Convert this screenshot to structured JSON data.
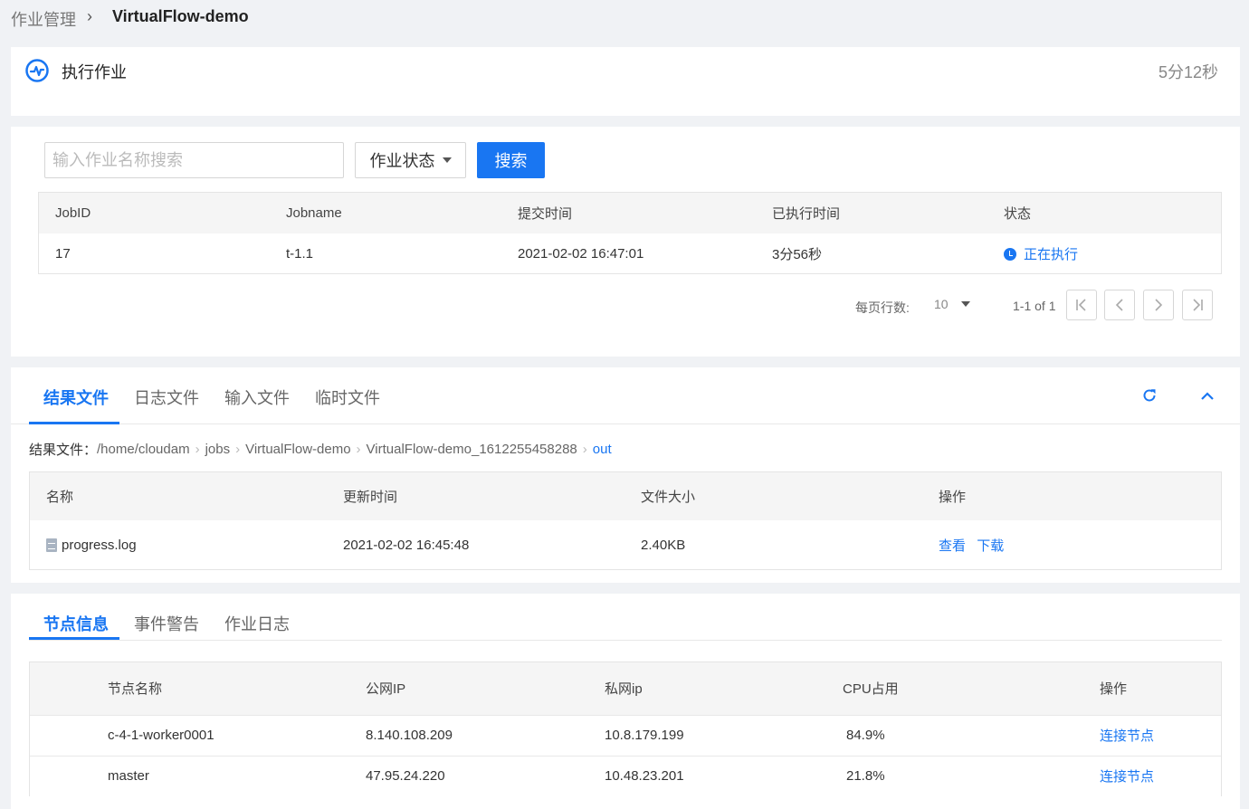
{
  "breadcrumb": {
    "root": "作业管理",
    "current": "VirtualFlow-demo"
  },
  "job_header": {
    "title": "执行作业",
    "elapsed": "5分12秒"
  },
  "search": {
    "placeholder": "输入作业名称搜索",
    "status_label": "作业状态",
    "button": "搜索"
  },
  "jobs_table": {
    "headers": [
      "JobID",
      "Jobname",
      "提交时间",
      "已执行时间",
      "状态"
    ],
    "rows": [
      {
        "id": "17",
        "name": "t-1.1",
        "submitted": "2021-02-02 16:47:01",
        "elapsed": "3分56秒",
        "status": "正在执行"
      }
    ]
  },
  "pager": {
    "rows_label": "每页行数:",
    "rows_value": "10",
    "range": "1-1 of 1"
  },
  "file_tabs": [
    "结果文件",
    "日志文件",
    "输入文件",
    "临时文件"
  ],
  "path": {
    "label": "结果文件：",
    "segments": [
      "/home/cloudam",
      "jobs",
      "VirtualFlow-demo",
      "VirtualFlow-demo_1612255458288"
    ],
    "current": "out"
  },
  "files_table": {
    "headers": [
      "名称",
      "更新时间",
      "文件大小",
      "操作"
    ],
    "rows": [
      {
        "name": "progress.log",
        "updated": "2021-02-02 16:45:48",
        "size": "2.40KB",
        "view": "查看",
        "download": "下载"
      }
    ]
  },
  "node_tabs": [
    "节点信息",
    "事件警告",
    "作业日志"
  ],
  "nodes_table": {
    "headers": [
      "节点名称",
      "公网IP",
      "私网ip",
      "CPU占用",
      "操作"
    ],
    "rows": [
      {
        "name": "c-4-1-worker0001",
        "public_ip": "8.140.108.209",
        "private_ip": "10.8.179.199",
        "cpu": "84.9%",
        "action": "连接节点"
      },
      {
        "name": "master",
        "public_ip": "47.95.24.220",
        "private_ip": "10.48.23.201",
        "cpu": "21.8%",
        "action": "连接节点"
      }
    ]
  },
  "colors": {
    "accent": "#1976f2"
  }
}
